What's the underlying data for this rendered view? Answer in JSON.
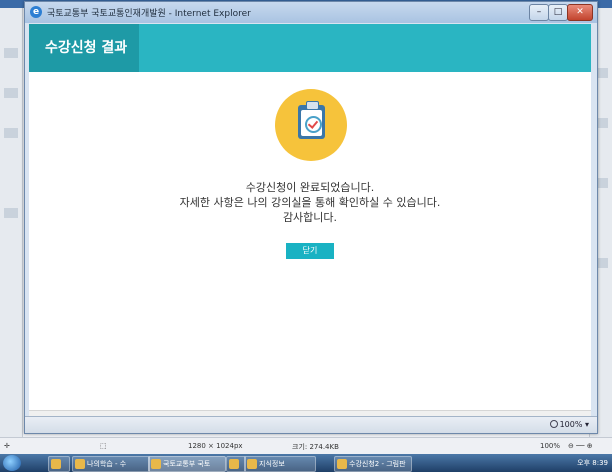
{
  "window": {
    "title": "국토교통부 국토교통인재개발원 - Internet Explorer",
    "controls": {
      "minimize": "–",
      "maximize": "□",
      "close": "✕"
    }
  },
  "page": {
    "title": "수강신청 결과",
    "icon": "clipboard-check-icon",
    "message_lines": [
      "수강신청이 완료되었습니다.",
      "자세한 사항은 나의 강의실을 통해 확인하실 수 있습니다.",
      "감사합니다."
    ],
    "close_button": "닫기"
  },
  "statusbar": {
    "zoom": "100%"
  },
  "viewer": {
    "dimensions": "1280 × 1024px",
    "size": "크기: 274.4KB",
    "zoom": "100%"
  },
  "taskbar": {
    "items": [
      "나의학습 - 수",
      "국토교통부 국토",
      "",
      "지식정보",
      "수강신청2 - 그림판"
    ],
    "clock": "오후 8:39"
  },
  "colors": {
    "header": "#2ab5c2",
    "header_title_bg": "#1e9aa6",
    "accent_badge": "#f6c33b",
    "button": "#19b2c3"
  }
}
